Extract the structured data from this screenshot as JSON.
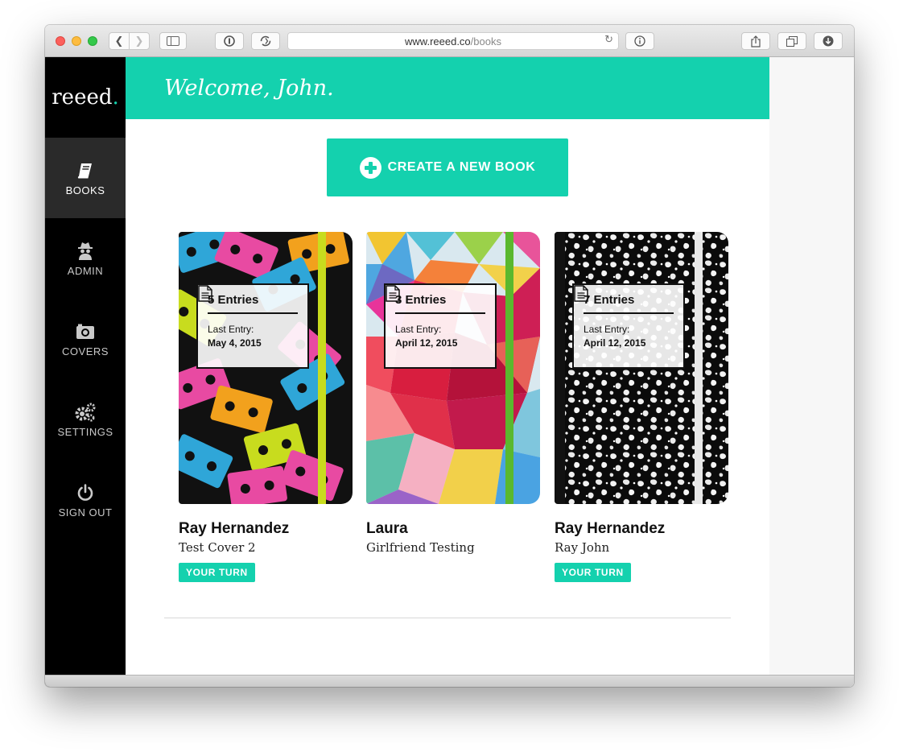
{
  "browser": {
    "url_domain": "www.reeed.co",
    "url_path": "/books"
  },
  "app": {
    "logo_text": "reeed",
    "logo_dot": "."
  },
  "sidebar": {
    "items": [
      {
        "label": "BOOKS",
        "icon": "book-icon",
        "active": true
      },
      {
        "label": "ADMIN",
        "icon": "spy-icon",
        "active": false
      },
      {
        "label": "COVERS",
        "icon": "camera-icon",
        "active": false
      },
      {
        "label": "SETTINGS",
        "icon": "gears-icon",
        "active": false
      },
      {
        "label": "SIGN OUT",
        "icon": "power-icon",
        "active": false
      }
    ]
  },
  "header": {
    "welcome": "Welcome, John."
  },
  "create_button": {
    "label": "CREATE A NEW BOOK"
  },
  "books": [
    {
      "entries": "5 Entries",
      "last_entry_label": "Last Entry:",
      "last_entry_date": "May 4, 2015",
      "name": "Ray Hernandez",
      "subtitle": "Test Cover 2",
      "badge": "YOUR TURN",
      "cover": "cassette-pattern",
      "band_color": "#c8dc1e"
    },
    {
      "entries": "3 Entries",
      "last_entry_label": "Last Entry:",
      "last_entry_date": "April 12, 2015",
      "name": "Laura",
      "subtitle": "Girlfriend Testing",
      "badge": "",
      "cover": "geometric-heart",
      "band_color": "#5ab82e"
    },
    {
      "entries": "7 Entries",
      "last_entry_label": "Last Entry:",
      "last_entry_date": "April 12, 2015",
      "name": "Ray Hernandez",
      "subtitle": "Ray John",
      "badge": "YOUR TURN",
      "cover": "composition-marble",
      "band_color": "#e8e8e8"
    }
  ],
  "colors": {
    "accent": "#14d1ae",
    "sidebar_bg": "#000000",
    "sidebar_active": "#2a2a2a"
  }
}
